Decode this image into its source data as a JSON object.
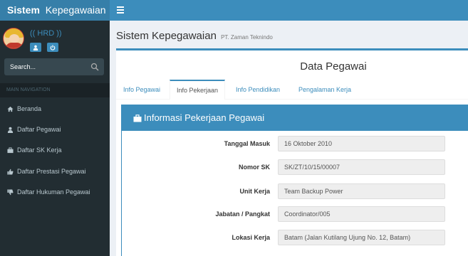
{
  "brand": {
    "bold": "Sistem",
    "rest": "Kepegawaian"
  },
  "user": {
    "name": "(( HRD ))"
  },
  "search": {
    "placeholder": "Search..."
  },
  "sidebar": {
    "header": "MAIN NAVIGATION",
    "items": [
      {
        "label": "Beranda",
        "icon": "home-icon"
      },
      {
        "label": "Daftar Pegawai",
        "icon": "user-icon"
      },
      {
        "label": "Daftar SK Kerja",
        "icon": "briefcase-icon"
      },
      {
        "label": "Daftar Prestasi Pegawai",
        "icon": "thumbs-up-icon"
      },
      {
        "label": "Daftar Hukuman Pegawai",
        "icon": "thumbs-down-icon"
      }
    ]
  },
  "page": {
    "title": "Sistem Kepegawaian",
    "subtitle": "PT. Zaman Teknindo"
  },
  "box": {
    "title": "Data Pegawai",
    "tabs": [
      {
        "label": "Info Pegawai"
      },
      {
        "label": "Info Pekerjaan"
      },
      {
        "label": "Info Pendidikan"
      },
      {
        "label": "Pengalaman Kerja"
      }
    ],
    "active_tab": "Info Pekerjaan"
  },
  "panel": {
    "title": "Informasi Pekerjaan Pegawai",
    "fields": [
      {
        "label": "Tanggal Masuk",
        "value": "16 Oktober 2010"
      },
      {
        "label": "Nomor SK",
        "value": "SK/ZT/10/15/00007"
      },
      {
        "label": "Unit Kerja",
        "value": "Team Backup Power"
      },
      {
        "label": "Jabatan / Pangkat",
        "value": "Coordinator/005"
      },
      {
        "label": "Lokasi Kerja",
        "value": "Batam (Jalan Kutilang Ujung No. 12, Batam)"
      }
    ]
  },
  "colors": {
    "primary": "#3c8dbc",
    "brand_bg": "#367fa9",
    "sidebar_bg": "#222d32",
    "sidebar_text": "#b8c7ce"
  }
}
